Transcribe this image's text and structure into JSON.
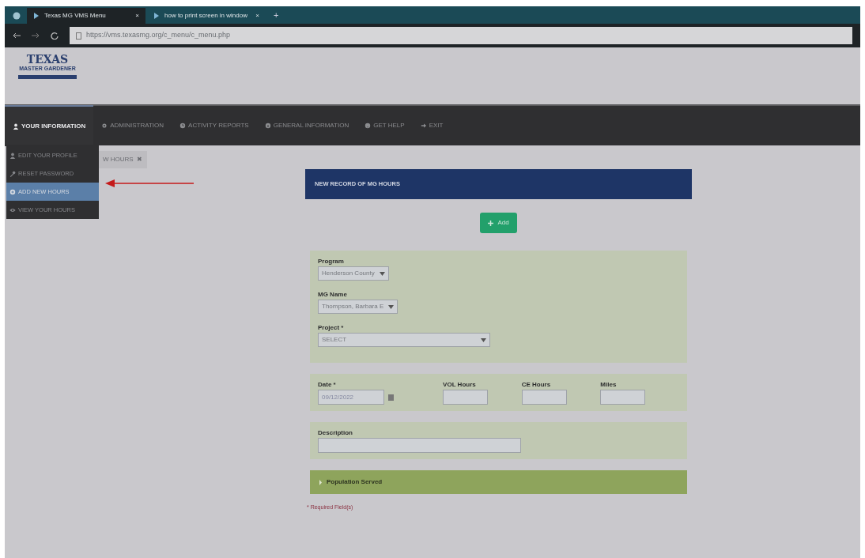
{
  "browser": {
    "tabs": [
      {
        "title": "Texas MG VMS Menu",
        "close": "×",
        "selected": true
      },
      {
        "title": "how to print screen in window",
        "close": "×",
        "selected": false
      }
    ],
    "new_tab": "+",
    "url": "https://vms.texasmg.org/c_menu/c_menu.php"
  },
  "logo": {
    "title": "TEXAS",
    "subtitle": "MASTER GARDENER"
  },
  "nav": [
    {
      "label": "YOUR INFORMATION",
      "selected": true
    },
    {
      "label": "ADMINISTRATION",
      "selected": false
    },
    {
      "label": "ACTIVITY REPORTS",
      "selected": false
    },
    {
      "label": "GENERAL INFORMATION",
      "selected": false
    },
    {
      "label": "GET HELP",
      "selected": false
    },
    {
      "label": "EXIT",
      "selected": false
    }
  ],
  "dropdown": [
    {
      "label": "EDIT YOUR PROFILE",
      "selected": false
    },
    {
      "label": "RESET PASSWORD",
      "selected": false
    },
    {
      "label": "ADD NEW HOURS",
      "selected": true
    },
    {
      "label": "VIEW YOUR HOURS",
      "selected": false
    }
  ],
  "page_tab": {
    "label": "W HOURS",
    "close": "✖"
  },
  "form": {
    "title": "NEW RECORD OF MG HOURS",
    "add_button": "Add",
    "sections": [
      {
        "fields": [
          {
            "kind": "select",
            "label": "Program",
            "value": "Henderson County"
          },
          {
            "kind": "select",
            "label": "MG Name",
            "value": "Thompson, Barbara E"
          },
          {
            "kind": "select",
            "label": "Project *",
            "value": "SELECT"
          }
        ]
      },
      {
        "fields": [
          {
            "kind": "date",
            "label": "Date *",
            "value": "09/12/2022"
          },
          {
            "kind": "text",
            "label": "VOL Hours"
          },
          {
            "kind": "text",
            "label": "CE Hours"
          },
          {
            "kind": "text",
            "label": "Miles"
          }
        ]
      },
      {
        "fields": [
          {
            "kind": "text",
            "label": "Description"
          }
        ]
      }
    ],
    "population": "Population Served",
    "required_note": "* Required Field(s)"
  }
}
